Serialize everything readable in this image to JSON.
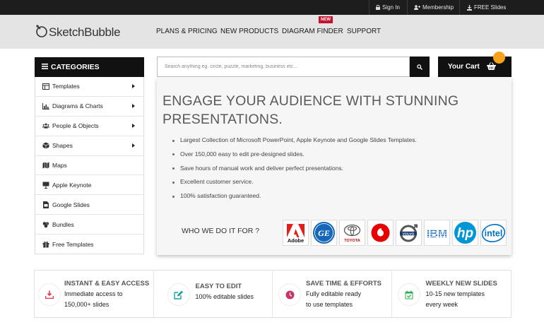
{
  "topbar": {
    "sign_in": "Sign In",
    "membership": "Membership",
    "free_slides": "FREE Slides"
  },
  "header": {
    "logo_text": "SketchBubble",
    "nav": [
      "PLANS & PRICING",
      "NEW PRODUCTS",
      "DIAGRAM FINDER",
      "SUPPORT"
    ],
    "new_badge": "NEW"
  },
  "sidebar": {
    "title": "CATEGORIES",
    "items": [
      {
        "label": "Templates",
        "icon": "templates-icon",
        "has_submenu": true
      },
      {
        "label": "Diagrams & Charts",
        "icon": "chart-icon",
        "has_submenu": true
      },
      {
        "label": "People & Objects",
        "icon": "people-icon",
        "has_submenu": true
      },
      {
        "label": "Shapes",
        "icon": "cube-icon",
        "has_submenu": true
      },
      {
        "label": "Maps",
        "icon": "map-icon",
        "has_submenu": false
      },
      {
        "label": "Apple Keynote",
        "icon": "keynote-icon",
        "has_submenu": false
      },
      {
        "label": "Google Slides",
        "icon": "slides-icon",
        "has_submenu": false
      },
      {
        "label": "Bundles",
        "icon": "bundle-icon",
        "has_submenu": false
      },
      {
        "label": "Free Templates",
        "icon": "gift-icon",
        "has_submenu": false
      }
    ]
  },
  "search": {
    "placeholder": "Search anything eg. circle, puzzle, marketing, business etc..."
  },
  "cart": {
    "label": "Your Cart"
  },
  "hero": {
    "title": "ENGAGE YOUR AUDIENCE WITH STUNNING PRESENTATIONS.",
    "bullets": [
      "Largest Collection of Microsoft PowerPoint, Apple Keynote and Google Slides Templates.",
      "Over 150,000 easy to edit pre-designed slides.",
      "Save hours of manual work and deliver perfect presentations.",
      "Excellent customer service.",
      "100% satisfaction guaranteed."
    ],
    "who_label": "WHO WE DO IT FOR ?",
    "brands": [
      {
        "name": "Adobe",
        "icon": "adobe-logo"
      },
      {
        "name": "GE",
        "icon": "ge-logo"
      },
      {
        "name": "TOYOTA",
        "icon": "toyota-logo"
      },
      {
        "name": "Vodafone",
        "icon": "vodafone-logo"
      },
      {
        "name": "VOLVO",
        "icon": "volvo-logo"
      },
      {
        "name": "IBM",
        "icon": "ibm-logo"
      },
      {
        "name": "hp",
        "icon": "hp-logo"
      },
      {
        "name": "intel",
        "icon": "intel-logo"
      }
    ]
  },
  "features": [
    {
      "title": "INSTANT & EASY ACCESS",
      "lines": [
        "Immediate access to",
        "150,000+ slides"
      ],
      "icon": "download-icon"
    },
    {
      "title": "EASY TO EDIT",
      "lines": [
        "100% editable slides"
      ],
      "icon": "edit-icon"
    },
    {
      "title": "SAVE TIME & EFFORTS",
      "lines": [
        "Fully editable ready",
        "to use templates"
      ],
      "icon": "clock-icon"
    },
    {
      "title": "WEEKLY NEW SLIDES",
      "lines": [
        "10-15 new templates",
        "every week"
      ],
      "icon": "calendar-check-icon"
    }
  ],
  "colors": {
    "topbar": "#1d1d1d",
    "header": "#e4e4e4",
    "dark": "#111111",
    "cart_badge": "#f7a21b",
    "new_badge": "#c8102e",
    "feature_accent": "#e53950"
  }
}
